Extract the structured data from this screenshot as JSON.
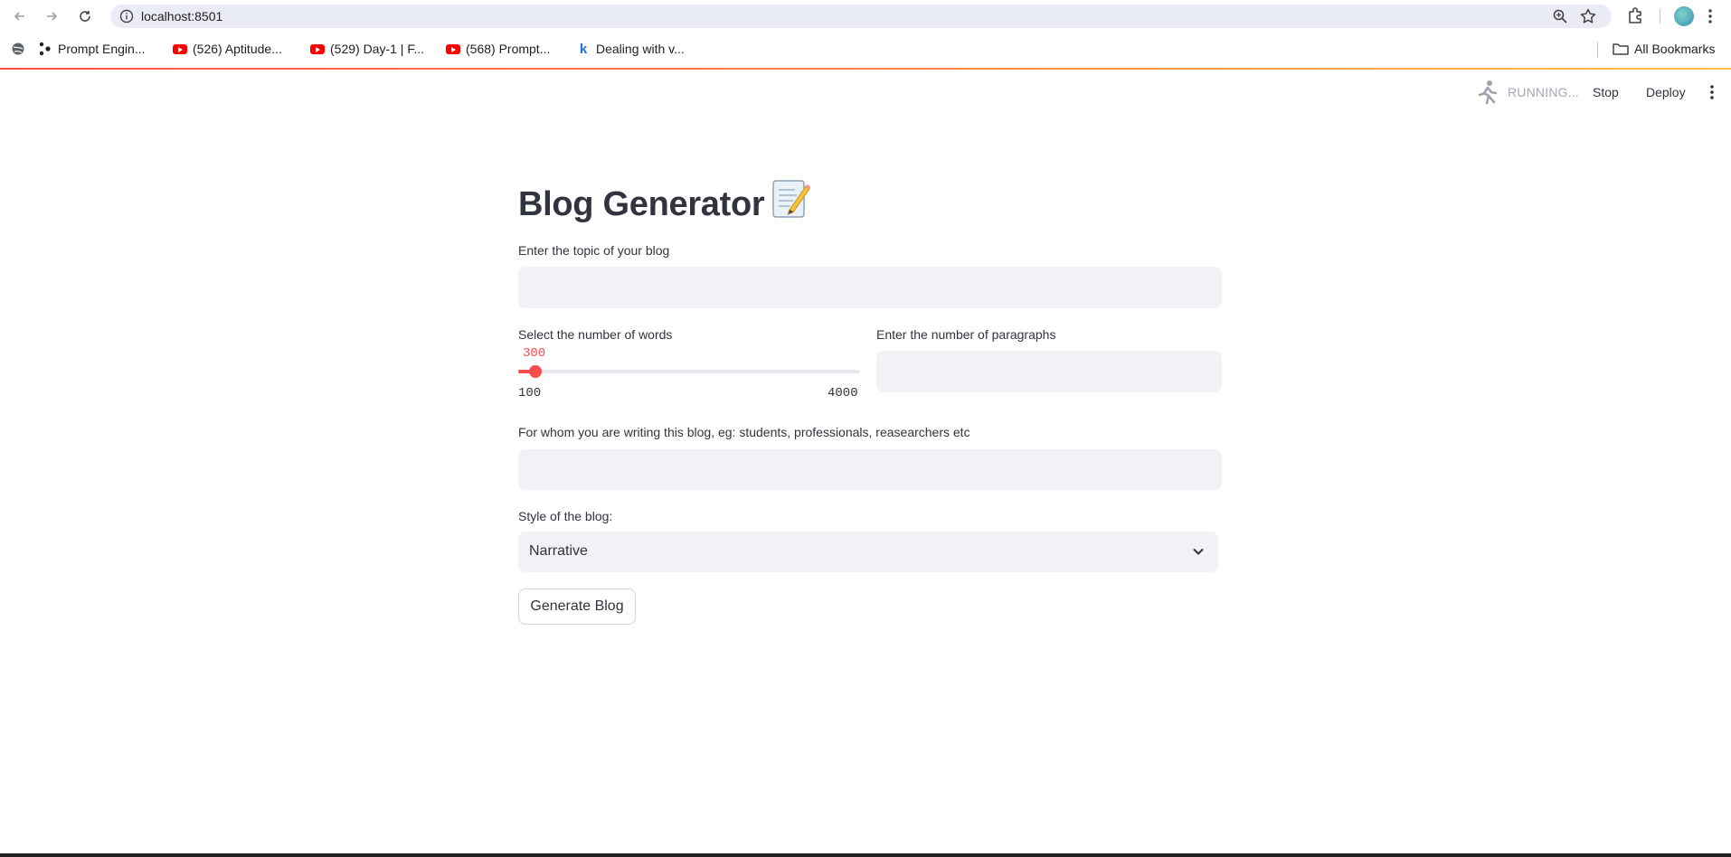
{
  "browser": {
    "url": "localhost:8501",
    "bookmarks": [
      {
        "label": "Prompt Engin...",
        "icon": "dots-icon"
      },
      {
        "label": "(526) Aptitude...",
        "icon": "youtube-icon"
      },
      {
        "label": "(529) Day-1 | F...",
        "icon": "youtube-icon"
      },
      {
        "label": "(568) Prompt...",
        "icon": "youtube-icon"
      },
      {
        "label": "Dealing with v...",
        "icon": "k-icon"
      }
    ],
    "all_bookmarks": "All Bookmarks"
  },
  "header": {
    "status": "RUNNING...",
    "stop": "Stop",
    "deploy": "Deploy"
  },
  "main": {
    "title": "Blog Generator",
    "topic_label": "Enter the topic of your blog",
    "topic_value": "",
    "words_label": "Select the number of words",
    "words_value": "300",
    "words_min": "100",
    "words_max": "4000",
    "words_fraction": 0.0513,
    "paragraphs_label": "Enter the number of paragraphs",
    "paragraphs_value": "",
    "audience_label": "For whom you are writing this blog, eg: students, professionals, reasearchers etc",
    "audience_value": "",
    "style_label": "Style of the blog:",
    "style_value": "Narrative",
    "generate_button": "Generate Blog"
  },
  "colors": {
    "accent": "#ff4b4b",
    "input_bg": "#f0f2f6",
    "text": "#31333f"
  }
}
